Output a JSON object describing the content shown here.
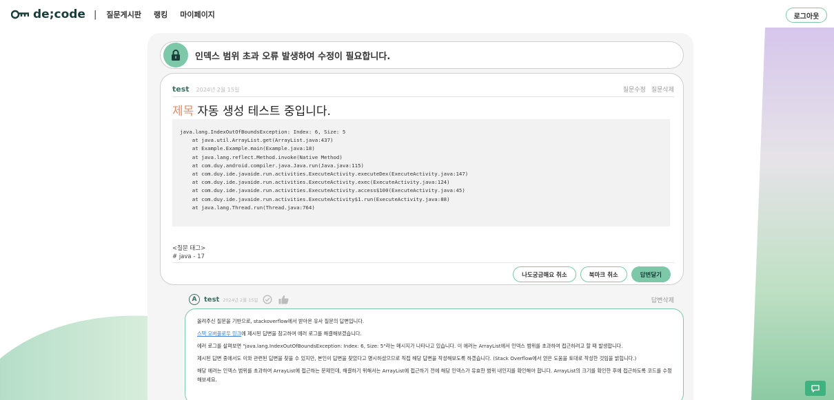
{
  "nav": {
    "logo_text": "de;code",
    "separator": "|",
    "items": [
      {
        "label": "질문게시판"
      },
      {
        "label": "랭킹"
      },
      {
        "label": "마이페이지"
      }
    ],
    "logout_label": "로그아웃"
  },
  "status": {
    "icon": "lock-icon",
    "text": "인덱스 범위 초과 오류 발생하여 수정이 필요합니다."
  },
  "question": {
    "author": "test",
    "date": "2024년 2월 15일",
    "edit_label": "질문수정",
    "delete_label": "질문삭제",
    "title_prefix": "제목",
    "title": "자동 생성 테스트 중입니다.",
    "code_lines": [
      "java.lang.IndexOutOfBoundsException: Index: 6, Size: 5",
      "    at java.util.ArrayList.get(ArrayList.java:437)",
      "    at Example.Example.main(Example.java:18)",
      "    at java.lang.reflect.Method.invoke(Native Method)",
      "    at com.duy.android.compiler.java.Java.run(Java.java:115)",
      "    at com.duy.ide.javaide.run.activities.ExecuteActivity.executeDex(ExecuteActivity.java:147)",
      "    at com.duy.ide.javaide.run.activities.ExecuteActivity.exec(ExecuteActivity.java:124)",
      "    at com.duy.ide.javaide.run.activities.ExecuteActivity.access$100(ExecuteActivity.java:45)",
      "    at com.duy.ide.javaide.run.activities.ExecuteActivity$1.run(ExecuteActivity.java:88)",
      "    at java.lang.Thread.run(Thread.java:764)"
    ],
    "tags_header": "<질문 태그>",
    "tags_value": "# java - 17",
    "buttons": {
      "curious_cancel": "나도궁금해요 취소",
      "bookmark_cancel": "북마크 취소",
      "answer": "답변달기"
    }
  },
  "answer": {
    "badge": "A",
    "author": "test",
    "date": "2024년 2월 15일",
    "delete_label": "답변삭제",
    "paragraphs": [
      {
        "text": "올려주신 질문을 기반으로, stackoverflow에서 받아온 유사 질문의 답변입니다."
      },
      {
        "link": "스택 오버플로우 링크",
        "text": "에 제시된 답변을 참고하여 에러 로그를 해결해보겠습니다."
      },
      {
        "text": "에러 로그를 살펴보면 \"java.lang.IndexOutOfBoundsException: Index: 6, Size: 5\"라는 메시지가 나타나고 있습니다. 이 에러는 ArrayList에서 인덱스 범위를 초과하여 접근하려고 할 때 발생합니다."
      },
      {
        "text": "제시된 답변 중에서도 이와 관련된 답변을 찾을 수 있지만, 본인이 답변을 찾았다고 명시하셨으므로 직접 해당 답변을 작성해보도록 하겠습니다. (Stack Overflow에서 얻은 도움을 토대로 작성한 것임을 밝힙니다.)"
      },
      {
        "text": "해당 에러는 인덱스 범위를 초과하여 ArrayList에 접근하는 문제인데, 해결하기 위해서는 ArrayList에 접근하기 전에 해당 인덱스가 유효한 범위 내인지를 확인해야 합니다. ArrayList의 크기를 확인한 후에 접근하도록 코드를 수정해보세요."
      }
    ]
  },
  "colors": {
    "accent_green": "#7cc8a8",
    "dark_green": "#3a6f62",
    "title_accent": "#e38d6a",
    "fab_green": "#3fb27f"
  }
}
